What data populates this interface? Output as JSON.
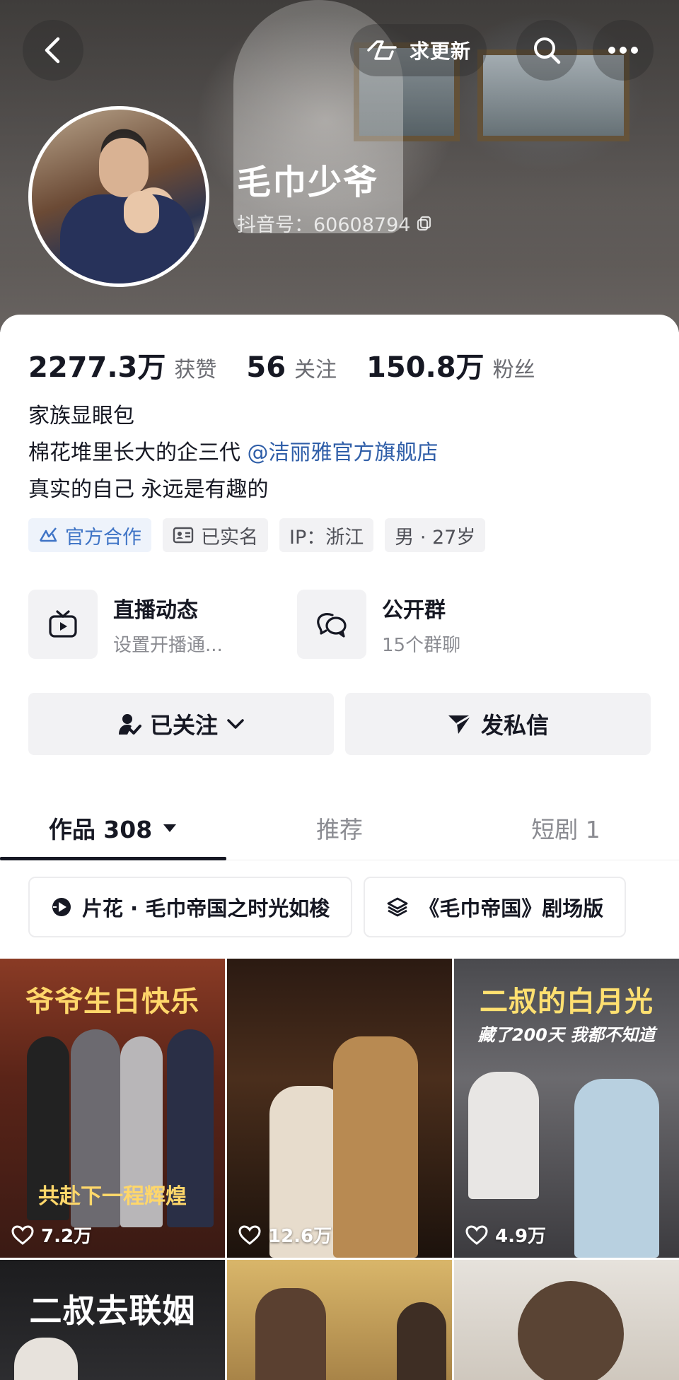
{
  "header": {
    "request_update_label": "求更新"
  },
  "profile": {
    "name": "毛巾少爷",
    "douyin_id": "抖音号：60608794"
  },
  "stats": [
    {
      "value": "2277.3万",
      "label": "获赞"
    },
    {
      "value": "56",
      "label": "关注"
    },
    {
      "value": "150.8万",
      "label": "粉丝"
    }
  ],
  "bio": {
    "line1": "家族显眼包",
    "line2_prefix": "棉花堆里长大的企三代 ",
    "line2_mention": "@洁丽雅官方旗舰店",
    "line3": "真实的自己 永远是有趣的"
  },
  "tags": [
    {
      "label": "官方合作",
      "icon": "official-cooperation-icon"
    },
    {
      "label": "已实名",
      "icon": "id-card-icon"
    },
    {
      "label": "IP：浙江"
    },
    {
      "label": "男 · 27岁"
    }
  ],
  "services": [
    {
      "title": "直播动态",
      "subtitle": "设置开播通...",
      "icon": "tv-icon"
    },
    {
      "title": "公开群",
      "subtitle": "15个群聊",
      "icon": "group-chat-icon"
    }
  ],
  "actions": {
    "follow_label": "已关注",
    "message_label": "发私信"
  },
  "tabs": [
    {
      "label": "作品 308",
      "active": true
    },
    {
      "label": "推荐",
      "active": false
    },
    {
      "label": "短剧 1",
      "active": false
    }
  ],
  "collections": [
    {
      "label": "片花 · 毛巾帝国之时光如梭",
      "icon": "play-collection-icon"
    },
    {
      "label": "《毛巾帝国》剧场版",
      "icon": "layers-icon"
    }
  ],
  "videos": [
    {
      "caption": "爷爷生日快乐",
      "bottom": "共赴下一程辉煌",
      "likes": "7.2万"
    },
    {
      "caption": "",
      "likes": "12.6万"
    },
    {
      "caption": "二叔的白月光",
      "sub": "藏了200天 我都不知道",
      "likes": "4.9万"
    },
    {
      "caption": "二叔去联姻",
      "likes": ""
    },
    {
      "caption": "",
      "likes": ""
    },
    {
      "caption": "",
      "likes": ""
    }
  ],
  "colors": {
    "mention": "#2f5ea8",
    "official_tag": "#3f74c6",
    "text_primary": "#161823",
    "text_secondary": "#8a8b91"
  }
}
